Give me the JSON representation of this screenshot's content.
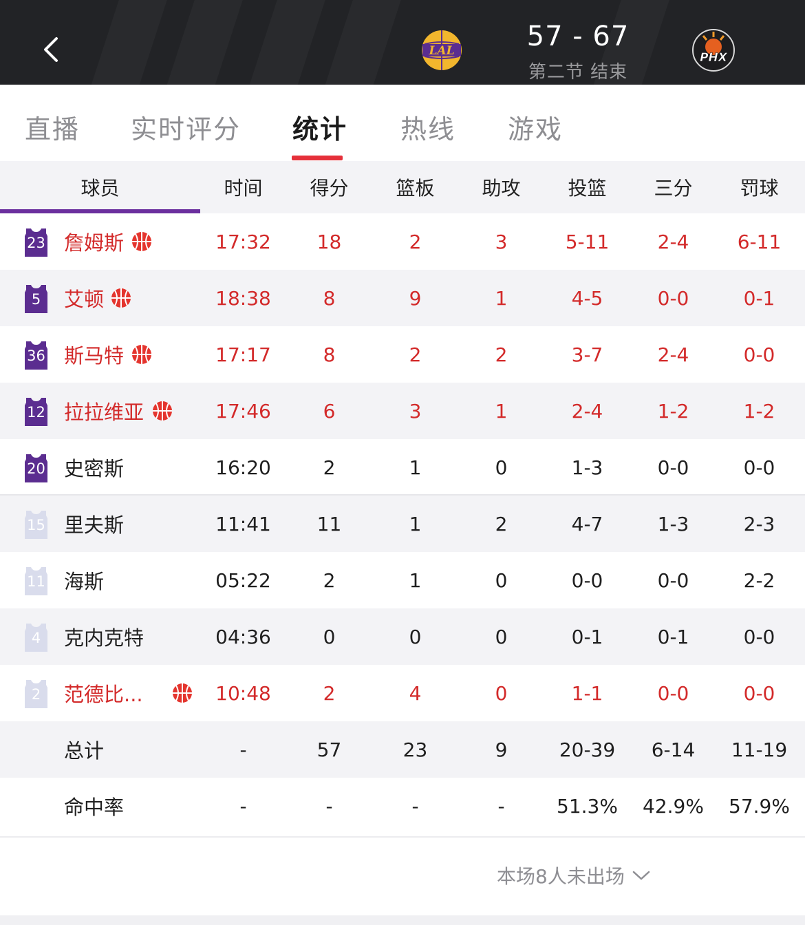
{
  "header": {
    "score": "57 - 67",
    "period": "第二节 结束",
    "home_logo_text": "LAL",
    "away_logo_text": "PHX"
  },
  "tabs": [
    {
      "label": "直播"
    },
    {
      "label": "实时评分"
    },
    {
      "label": "统计",
      "active": true
    },
    {
      "label": "热线"
    },
    {
      "label": "游戏"
    }
  ],
  "table": {
    "columns": [
      "球员",
      "时间",
      "得分",
      "篮板",
      "助攻",
      "投篮",
      "三分",
      "罚球"
    ],
    "players": [
      {
        "number": "23",
        "name": "詹姆斯",
        "starter": true,
        "highlight": true,
        "ball": true,
        "stats": [
          "17:32",
          "18",
          "2",
          "3",
          "5-11",
          "2-4",
          "6-11"
        ]
      },
      {
        "number": "5",
        "name": "艾顿",
        "starter": true,
        "highlight": true,
        "ball": true,
        "stats": [
          "18:38",
          "8",
          "9",
          "1",
          "4-5",
          "0-0",
          "0-1"
        ]
      },
      {
        "number": "36",
        "name": "斯马特",
        "starter": true,
        "highlight": true,
        "ball": true,
        "stats": [
          "17:17",
          "8",
          "2",
          "2",
          "3-7",
          "2-4",
          "0-0"
        ]
      },
      {
        "number": "12",
        "name": "拉拉维亚",
        "starter": true,
        "highlight": true,
        "ball": true,
        "stats": [
          "17:46",
          "6",
          "3",
          "1",
          "2-4",
          "1-2",
          "1-2"
        ]
      },
      {
        "number": "20",
        "name": "史密斯",
        "starter": true,
        "highlight": false,
        "ball": false,
        "stats": [
          "16:20",
          "2",
          "1",
          "0",
          "1-3",
          "0-0",
          "0-0"
        ]
      },
      {
        "number": "15",
        "name": "里夫斯",
        "starter": false,
        "highlight": false,
        "ball": false,
        "stats": [
          "11:41",
          "11",
          "1",
          "2",
          "4-7",
          "1-3",
          "2-3"
        ]
      },
      {
        "number": "11",
        "name": "海斯",
        "starter": false,
        "highlight": false,
        "ball": false,
        "stats": [
          "05:22",
          "2",
          "1",
          "0",
          "0-0",
          "0-0",
          "2-2"
        ]
      },
      {
        "number": "4",
        "name": "克内克特",
        "starter": false,
        "highlight": false,
        "ball": false,
        "stats": [
          "04:36",
          "0",
          "0",
          "0",
          "0-1",
          "0-1",
          "0-0"
        ]
      },
      {
        "number": "2",
        "name": "范德比...",
        "starter": false,
        "highlight": true,
        "ball": true,
        "stats": [
          "10:48",
          "2",
          "4",
          "0",
          "1-1",
          "0-0",
          "0-0"
        ]
      }
    ],
    "totals": {
      "label": "总计",
      "stats": [
        "-",
        "57",
        "23",
        "9",
        "20-39",
        "6-14",
        "11-19"
      ]
    },
    "percent": {
      "label": "命中率",
      "stats": [
        "-",
        "-",
        "-",
        "-",
        "51.3%",
        "42.9%",
        "57.9%"
      ]
    }
  },
  "footer": {
    "more_label": "本场8人未出场"
  },
  "colors": {
    "header_bg": "#222326",
    "accent_red": "#e5303a",
    "stat_red": "#d32a2a",
    "lakers_purple": "#5b2d90",
    "bench_jersey": "#d9dcec"
  }
}
